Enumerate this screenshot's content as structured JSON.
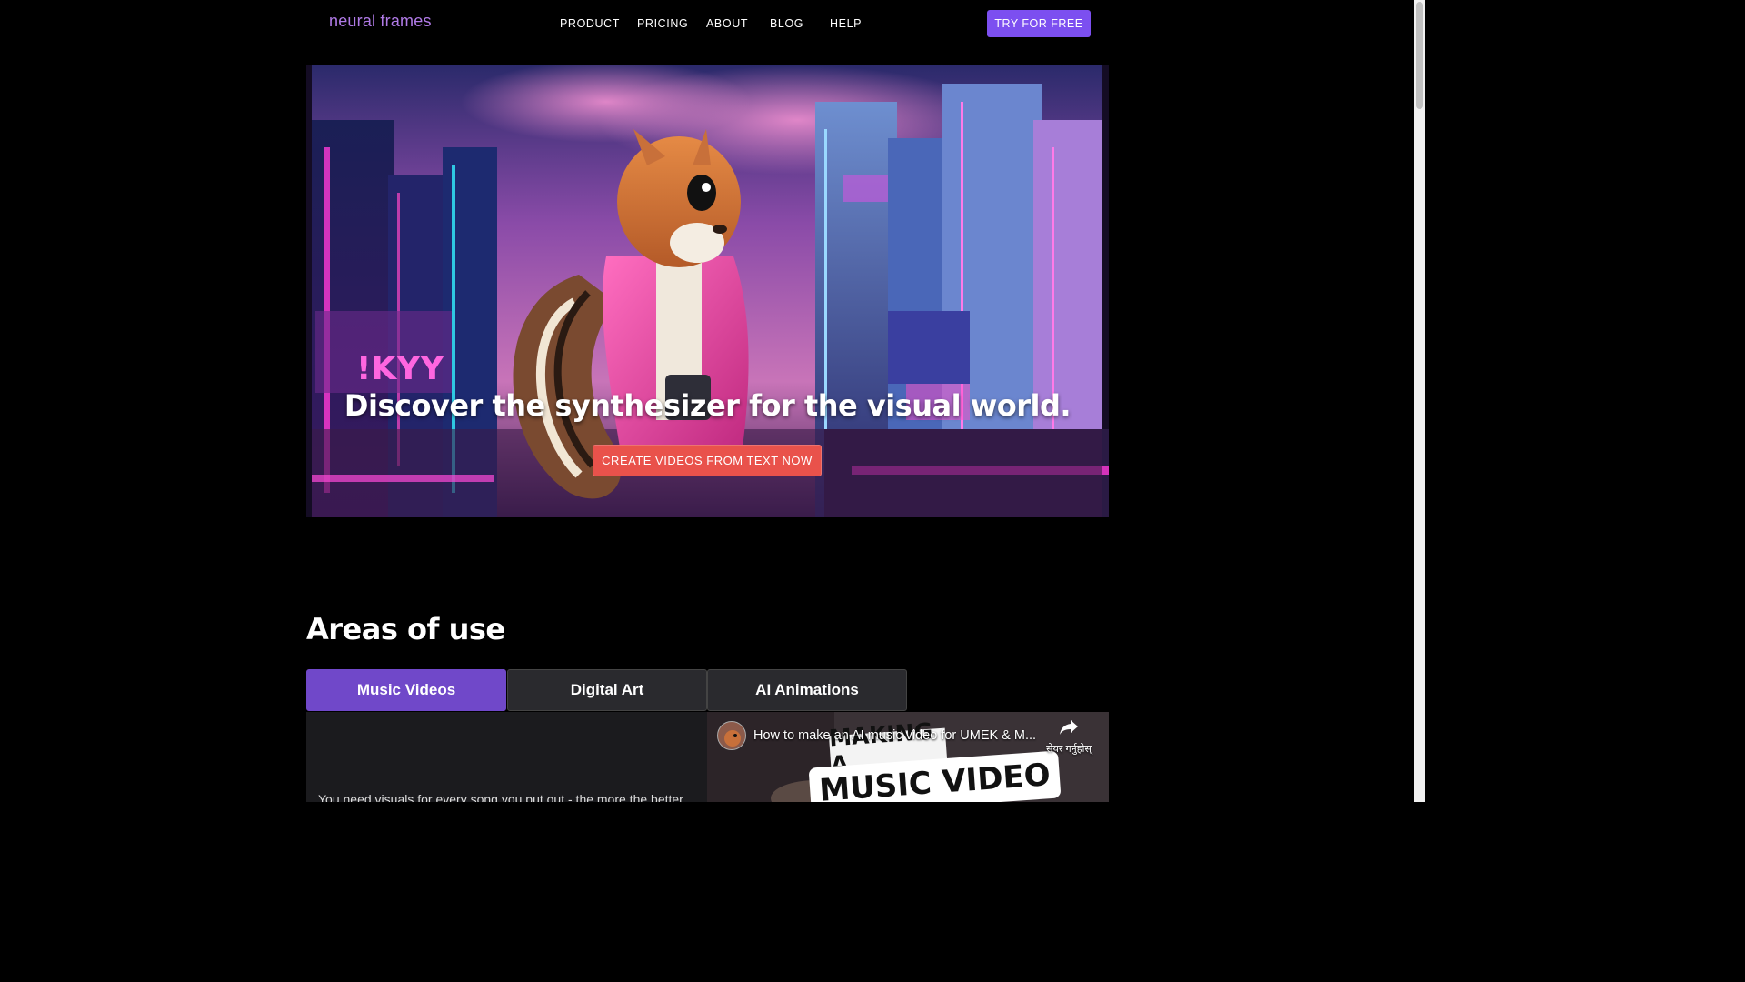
{
  "header": {
    "logo": "neural frames",
    "nav": [
      "PRODUCT",
      "PRICING",
      "ABOUT",
      "BLOG",
      "HELP"
    ],
    "cta": "TRY FOR FREE"
  },
  "hero": {
    "title": "Discover the synthesizer for the visual world.",
    "cta": "CREATE VIDEOS FROM TEXT NOW"
  },
  "areas": {
    "title": "Areas of use",
    "tabs": [
      {
        "label": "Music Videos",
        "active": true
      },
      {
        "label": "Digital Art",
        "active": false
      },
      {
        "label": "AI Animations",
        "active": false
      }
    ],
    "description": "You need visuals for every song you put out - the more the better."
  },
  "video": {
    "title": "How to make an AI music video for UMEK & M...",
    "share_label": "सेयर गर्नुहोस्",
    "banner_line1": "MAKING A",
    "banner_line2": "MUSIC VIDEO"
  },
  "colors": {
    "accent": "#7c4ff0",
    "hero_cta": "#e9524b",
    "active_tab": "#7048c9",
    "logo": "#b07ae6"
  }
}
